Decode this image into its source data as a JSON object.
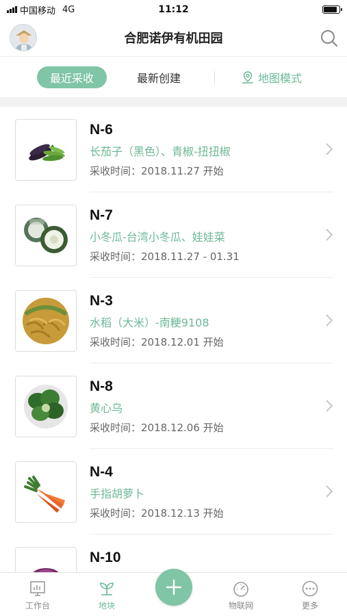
{
  "status_bar": {
    "carrier": "中国移动",
    "network": "4G",
    "time": "11:12",
    "battery_level": 0.85
  },
  "header": {
    "title": "合肥诺伊有机田园",
    "avatar_icon": "farmer-avatar-icon",
    "search_icon": "search-icon"
  },
  "tabs": {
    "recent_harvest": "最近采收",
    "newest_created": "最新创建",
    "map_mode": "地图模式"
  },
  "colors": {
    "accent": "#7fc5a6",
    "accent_text": "#6cb995"
  },
  "plots": [
    {
      "code": "N-6",
      "crops": "长茄子（黑色）、青椒-扭扭椒",
      "harvest_time": "采收时间：2018.11.27 开始",
      "icon": "eggplant-pepper-icon"
    },
    {
      "code": "N-7",
      "crops": "小冬瓜-台湾小冬瓜、娃娃菜",
      "harvest_time": "采收时间：2018.11.27 - 01.31",
      "icon": "wax-gourd-icon"
    },
    {
      "code": "N-3",
      "crops": "水稻（大米）-南粳9108",
      "harvest_time": "采收时间：2018.12.01 开始",
      "icon": "rice-field-icon"
    },
    {
      "code": "N-8",
      "crops": "黄心乌",
      "harvest_time": "采收时间：2018.12.06 开始",
      "icon": "bok-choy-icon"
    },
    {
      "code": "N-4",
      "crops": "手指胡萝卜",
      "harvest_time": "采收时间：2018.12.13 开始",
      "icon": "carrot-icon"
    },
    {
      "code": "N-10",
      "crops": "",
      "harvest_time": "",
      "icon": "purple-cabbage-icon"
    }
  ],
  "bottom_nav": {
    "workbench": "工作台",
    "plots": "地块",
    "add": "add-icon",
    "iot": "物联网",
    "more": "更多"
  }
}
